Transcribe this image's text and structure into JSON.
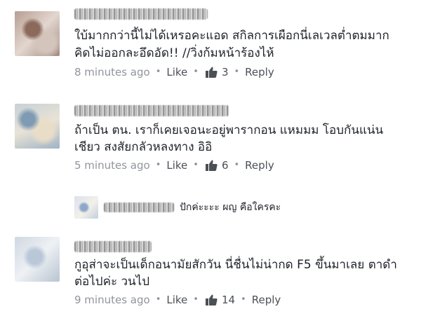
{
  "comments": [
    {
      "lines": [
        "ใบ้มากกว่านี้ไม่ได้เหรอคะแอด สกิลการเผือกนี่เลเวลต่ำตมมาก",
        "คิดไม่ออกละอึดอัด!! //วิ่งก้มหน้าร้องไห้"
      ],
      "time": "8 minutes ago",
      "like": "Like",
      "likes": "3",
      "reply": "Reply"
    },
    {
      "lines": [
        "ถ้าเป็น ตน. เราก็เคยเจอนะอยู่พารากอน แหมมม โอบกันแน่น",
        "เชียว สงสัยกลัวหลงทาง อิอิ"
      ],
      "time": "5 minutes ago",
      "like": "Like",
      "likes": "6",
      "reply": "Reply"
    },
    {
      "lines": [
        "กูอุส่าจะเป็นเด็กอนามัยสักวัน นี่ชื่นไม่น่ากด F5 ขึ้นมาเลย ตาดำ",
        "ต่อไปค่ะ วนไป"
      ],
      "time": "9 minutes ago",
      "like": "Like",
      "likes": "14",
      "reply": "Reply"
    }
  ],
  "reply_preview": {
    "text": "ปักค่ะะะะ ผญ คือใครคะ"
  },
  "colors": {
    "text": "#1d2129",
    "meta": "#90949c",
    "thumb": "#4b4f56"
  }
}
